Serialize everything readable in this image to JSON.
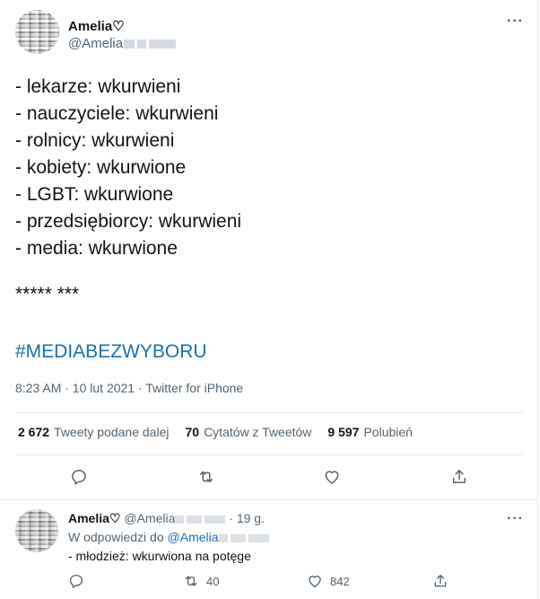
{
  "tweet": {
    "author_name": "Amelia♡",
    "author_handle": "@Amelia",
    "lines": [
      "- lekarze: wkurwieni",
      "- nauczyciele: wkurwieni",
      "- rolnicy: wkurwieni",
      "- kobiety: wkurwione",
      "- LGBT: wkurwione",
      "- przedsiębiorcy: wkurwieni",
      "- media: wkurwione"
    ],
    "stars": "***** ***",
    "hashtag": "#MEDIABEZWYBORU",
    "meta": "8:23 AM · 10 lut 2021 · Twitter for iPhone",
    "stats": {
      "retweets_count": "2 672",
      "retweets_label": "Tweety podane dalej",
      "quotes_count": "70",
      "quotes_label": "Cytatów z Tweetów",
      "likes_count": "9 597",
      "likes_label": "Polubień"
    }
  },
  "reply": {
    "author_name": "Amelia♡",
    "author_handle": "@Amelia",
    "time": "· 19 g.",
    "reply_to_prefix": "W odpowiedzi do",
    "reply_to_handle": "@Amelia",
    "text": "- młodzież: wkurwiona na potęge",
    "retweets": "40",
    "likes": "842"
  },
  "icons": {
    "more": "more-horizontal-icon",
    "reply": "reply-icon",
    "retweet": "retweet-icon",
    "like": "heart-icon",
    "share": "share-icon"
  },
  "colors": {
    "text": "#0f1419",
    "secondary": "#536471",
    "link": "#1b6fb5",
    "divider": "#e6ecf0"
  }
}
